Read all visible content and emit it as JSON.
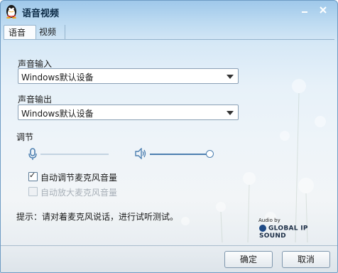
{
  "window": {
    "title": "语音视频"
  },
  "tabs": [
    {
      "label": "语音",
      "active": true
    },
    {
      "label": "视频",
      "active": false
    }
  ],
  "input_section": {
    "label": "声音输入",
    "device": "Windows默认设备"
  },
  "output_section": {
    "label": "声音输出",
    "device": "Windows默认设备"
  },
  "adjust": {
    "label": "调节",
    "mic_volume": 0,
    "speaker_volume": 1.0
  },
  "checkboxes": [
    {
      "label": "自动调节麦克风音量",
      "checked": true,
      "enabled": true
    },
    {
      "label": "自动放大麦克风音量",
      "checked": false,
      "enabled": false
    }
  ],
  "hint": "提示：请对着麦克风说话，进行试听测试。",
  "branding": {
    "audio_by": "Audio by",
    "name": "GLOBAL IP SOUND"
  },
  "buttons": {
    "ok": "确定",
    "cancel": "取消"
  },
  "colors": {
    "accent": "#4d7fb0",
    "title_bar": "#9fc8ea"
  }
}
